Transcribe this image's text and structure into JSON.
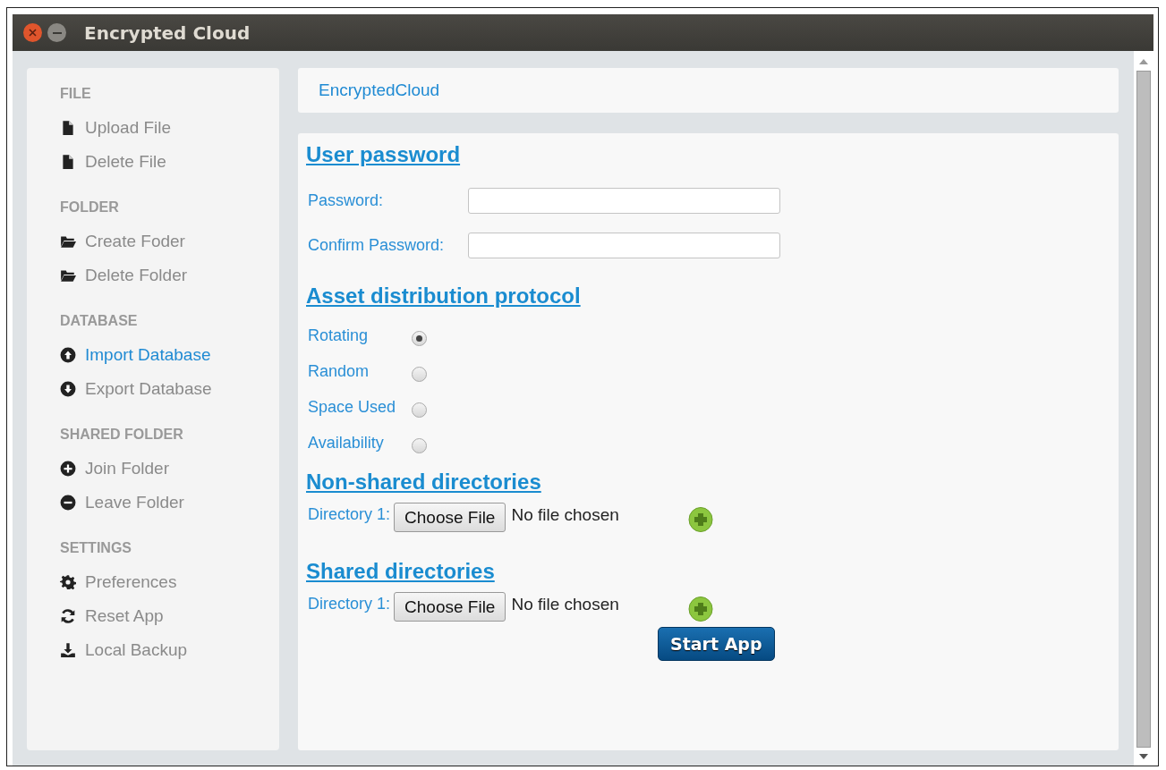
{
  "window": {
    "title": "Encrypted Cloud"
  },
  "sidebar": {
    "sections": [
      {
        "heading": "FILE",
        "items": [
          {
            "label": "Upload File",
            "kind": "file",
            "selected": false
          },
          {
            "label": "Delete File",
            "kind": "file",
            "selected": false
          }
        ]
      },
      {
        "heading": "FOLDER",
        "items": [
          {
            "label": "Create Foder",
            "kind": "folder",
            "selected": false
          },
          {
            "label": "Delete Folder",
            "kind": "folder",
            "selected": false
          }
        ]
      },
      {
        "heading": "DATABASE",
        "items": [
          {
            "label": "Import Database",
            "kind": "up",
            "selected": true
          },
          {
            "label": "Export Database",
            "kind": "down",
            "selected": false
          }
        ]
      },
      {
        "heading": "SHARED FOLDER",
        "items": [
          {
            "label": "Join Folder",
            "kind": "plus",
            "selected": false
          },
          {
            "label": "Leave Folder",
            "kind": "minus",
            "selected": false
          }
        ]
      },
      {
        "heading": "SETTINGS",
        "items": [
          {
            "label": "Preferences",
            "kind": "gear",
            "selected": false
          },
          {
            "label": "Reset App",
            "kind": "refresh",
            "selected": false
          },
          {
            "label": "Local Backup",
            "kind": "download",
            "selected": false
          }
        ]
      }
    ]
  },
  "header": {
    "brand": "EncryptedCloud"
  },
  "form": {
    "password_heading": "User password",
    "fields": [
      {
        "label": "Password:"
      },
      {
        "label": "Confirm Password:"
      }
    ],
    "protocol_heading": "Asset distribution protocol",
    "protocols": [
      {
        "label": "Rotating",
        "selected": true
      },
      {
        "label": "Random",
        "selected": false
      },
      {
        "label": "Space Used",
        "selected": false
      },
      {
        "label": "Availability",
        "selected": false
      }
    ],
    "directory_groups": [
      {
        "heading": "Non-shared directories",
        "rows": [
          {
            "label": "Directory 1:",
            "button": "Choose File",
            "status": "No file chosen"
          }
        ]
      },
      {
        "heading": "Shared directories",
        "rows": [
          {
            "label": "Directory 1:",
            "button": "Choose File",
            "status": "No file chosen"
          }
        ]
      }
    ],
    "start_button": "Start App"
  }
}
